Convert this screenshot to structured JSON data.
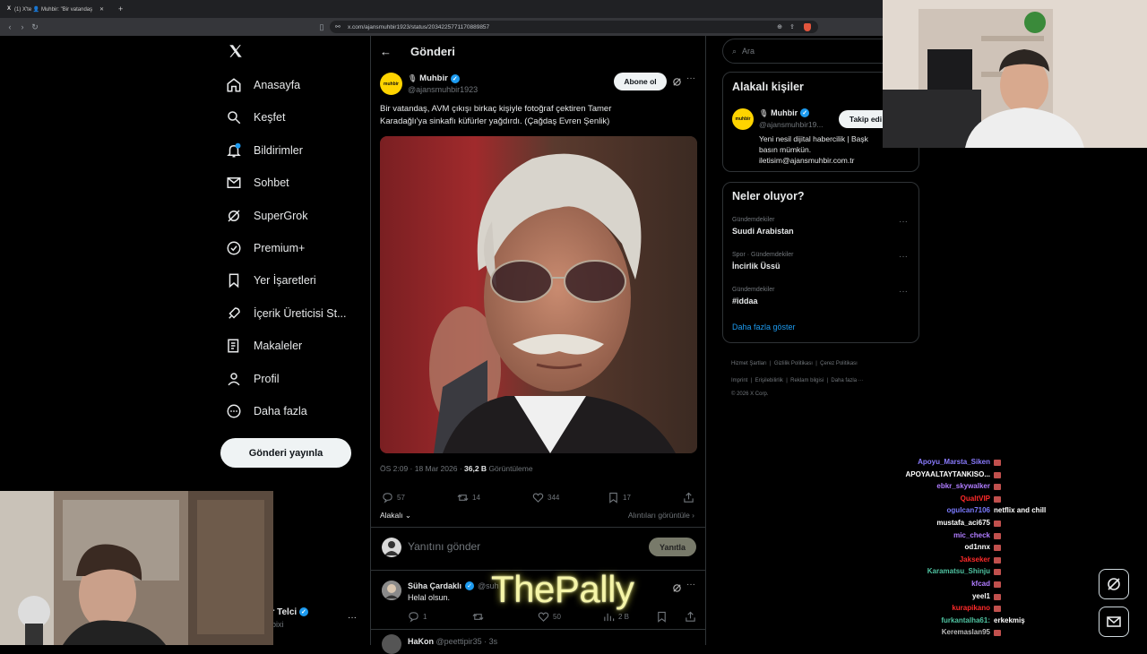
{
  "browser": {
    "tabs": [
      {
        "label": "(1) X'te 👤 Muhbir: \"Bir vatandaş"
      },
      {
        "label": "👤 Muhbir: \"Bir vatandaş"
      }
    ],
    "new_tab": "+",
    "url": "x.com/ajansmuhbir1923/status/2034225771170889857"
  },
  "nav": {
    "logo": "X",
    "items": [
      {
        "label": "Anasayfa",
        "icon": "home-icon"
      },
      {
        "label": "Keşfet",
        "icon": "search-icon"
      },
      {
        "label": "Bildirimler",
        "icon": "bell-icon"
      },
      {
        "label": "Sohbet",
        "icon": "mail-icon"
      },
      {
        "label": "SuperGrok",
        "icon": "grok-icon"
      },
      {
        "label": "Premium+",
        "icon": "verified-icon"
      },
      {
        "label": "Yer İşaretleri",
        "icon": "bookmark-icon"
      },
      {
        "label": "İçerik Üreticisi St...",
        "icon": "rocket-icon"
      },
      {
        "label": "Makaleler",
        "icon": "article-icon"
      },
      {
        "label": "Profil",
        "icon": "profile-icon"
      },
      {
        "label": "Daha fazla",
        "icon": "more-circle-icon"
      }
    ],
    "post_button": "Gönderi yayınla",
    "account_name": "adır Telci",
    "account_handle": "rplebixi",
    "account_more": "···"
  },
  "header": {
    "title": "Gönderi",
    "back": "←"
  },
  "tweet": {
    "author": "Muhbir",
    "handle": "@ajansmuhbir1923",
    "avatar_text": "muhbir",
    "subscribe": "Abone ol",
    "text": "Bir vatandaş, AVM çıkışı birkaç kişiyle fotoğraf çektiren Tamer Karadağlı'ya sinkaflı küfürler yağdırdı. (Çağdaş Evren Şenlik)",
    "time": "ÖS 2:09 · 18 Mar 2026 · ",
    "views": "36,2 B",
    "views_label": " Görüntüleme",
    "replies": "57",
    "retweets": "14",
    "likes": "344",
    "bookmarks": "17",
    "sort": "Alakalı",
    "quotes_link": "Alıntıları görüntüle"
  },
  "reply_box": {
    "placeholder": "Yanıtını gönder",
    "button": "Yanıtla"
  },
  "replies": [
    {
      "name": "Süha Çardaklı",
      "handle": "@suh",
      "text": "Helal olsun.",
      "replies": "1",
      "retweets": "",
      "likes": "50",
      "views": "2 B"
    },
    {
      "name": "HaKon",
      "handle": "@peettipir35 · 3s",
      "text": ""
    }
  ],
  "overlay_text": "ThePally",
  "search": {
    "placeholder": "Ara"
  },
  "related": {
    "title": "Alakalı kişiler",
    "name": "Muhbir",
    "handle": "@ajansmuhbir19...",
    "follow": "Takip edi",
    "bio_line1": "Yeni nesil dijital habercilik | Başk",
    "bio_line2": "basın mümkün.",
    "bio_line3": "iletisim@ajansmuhbir.com.tr"
  },
  "trends": {
    "title": "Neler oluyor?",
    "items": [
      {
        "meta": "Gündemdekiler",
        "name": "Suudi Arabistan"
      },
      {
        "meta": "Spor · Gündemdekiler",
        "name": "İncirlik Üssü"
      },
      {
        "meta": "Gündemdekiler",
        "name": "#iddaa"
      }
    ],
    "show_more": "Daha fazla göster"
  },
  "footer": {
    "line1": [
      "Hizmet Şartları",
      "Gizlilik Politikası",
      "Çerez Politikası"
    ],
    "line2": [
      "Imprint",
      "Erişilebilirlik",
      "Reklam bilgisi",
      "Daha fazla ···"
    ],
    "copyright": "© 2026 X Corp."
  },
  "chat": [
    {
      "user": "Apoyu_Marsta_Siken",
      "color": "#8a7bff",
      "message": ""
    },
    {
      "user": "APOYAALTAYTANKISO...",
      "color": "#ffffff",
      "message": ""
    },
    {
      "user": "ebkr_skywalker",
      "color": "#b07cff",
      "message": ""
    },
    {
      "user": "QualtVIP",
      "color": "#ff2a2a",
      "message": ""
    },
    {
      "user": "ogulcan7106",
      "color": "#7b7bff",
      "message": "netflix and chill"
    },
    {
      "user": "mustafa_aci675",
      "color": "#ffffff",
      "message": ""
    },
    {
      "user": "mic_check",
      "color": "#b07cff",
      "message": ""
    },
    {
      "user": "od1nnx",
      "color": "#ffffff",
      "message": ""
    },
    {
      "user": "Jakseker",
      "color": "#ff2a2a",
      "message": ""
    },
    {
      "user": "Karamatsu_Shinju",
      "color": "#4fc3a1",
      "message": ""
    },
    {
      "user": "kfcad",
      "color": "#b07cff",
      "message": ""
    },
    {
      "user": "yeel1",
      "color": "#ffffff",
      "message": ""
    },
    {
      "user": "kurapikano",
      "color": "#ff2a2a",
      "message": ""
    },
    {
      "user": "furkantalha61:",
      "color": "#4fc3a1",
      "message": "erkekmiş"
    },
    {
      "user": "Keremaslan95",
      "color": "#bbbbbb",
      "message": ""
    }
  ]
}
